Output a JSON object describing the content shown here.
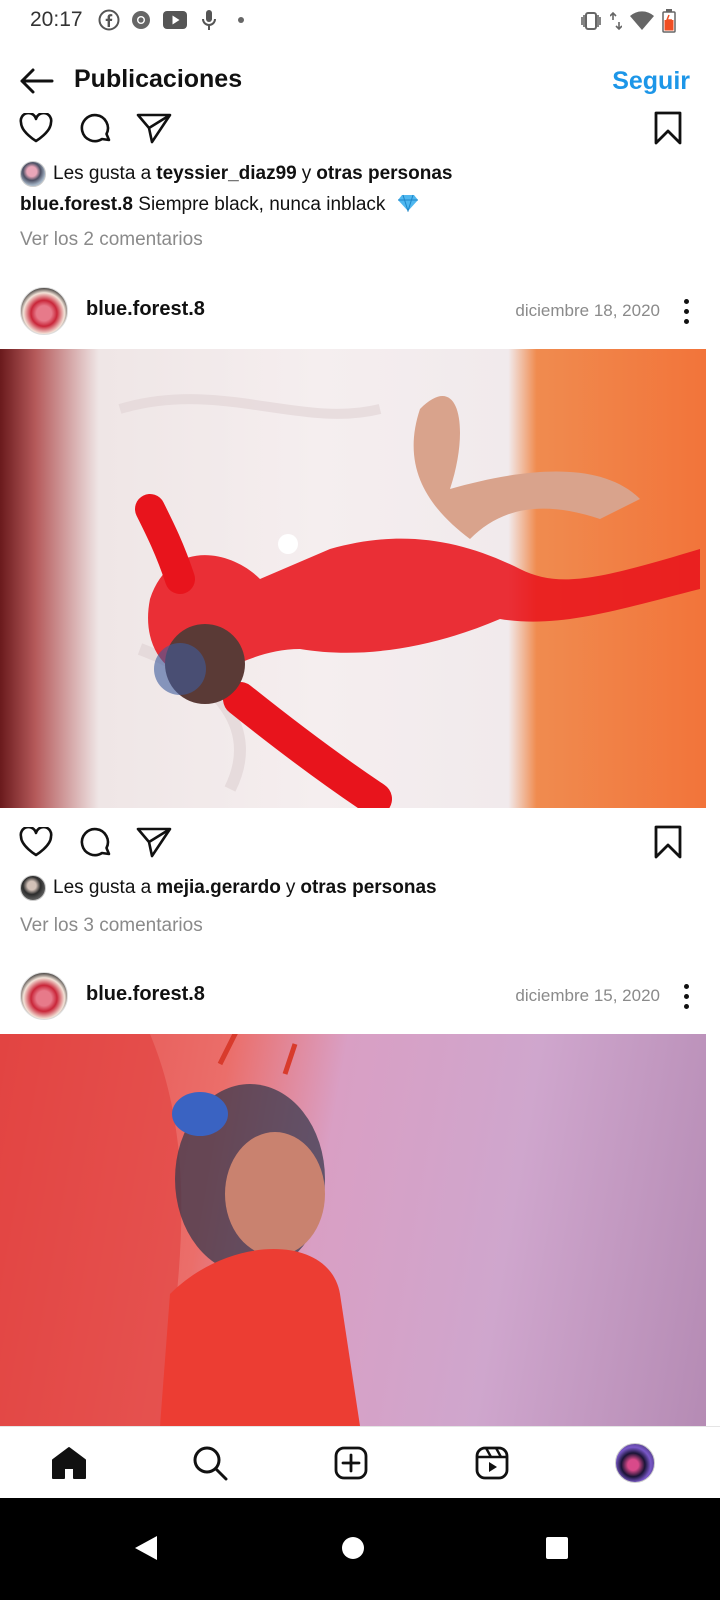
{
  "status_bar": {
    "time": "20:17",
    "icons": [
      "facebook-icon",
      "chrome-icon",
      "youtube-icon",
      "mic-icon",
      "dot-icon"
    ],
    "right_icons": [
      "vibrate-icon",
      "data-arrows-icon",
      "wifi-icon",
      "battery-icon"
    ],
    "battery_color": "#f04e23"
  },
  "nav": {
    "title": "Publicaciones",
    "follow_label": "Seguir",
    "accent": "#1c96e8"
  },
  "posts": [
    {
      "liked_by_prefix": "Les gusta a",
      "liked_by_user": "teyssier_diaz99",
      "liked_by_join": "y",
      "liked_by_others": "otras personas",
      "caption_user": "blue.forest.8",
      "caption_text": "Siempre black, nunca inblack",
      "caption_emoji": "gem-icon",
      "comments_link": "Ver los 2 comentarios"
    },
    {
      "username": "blue.forest.8",
      "date": "diciembre 18, 2020",
      "liked_by_prefix": "Les gusta a",
      "liked_by_user": "mejia.gerardo",
      "liked_by_join": "y",
      "liked_by_others": "otras personas",
      "comments_link": "Ver los 3 comentarios"
    },
    {
      "username": "blue.forest.8",
      "date": "diciembre 15, 2020"
    }
  ],
  "bottom_nav": [
    "home-icon",
    "search-icon",
    "new-post-icon",
    "reels-icon",
    "profile-avatar"
  ],
  "system_nav": [
    "back-icon",
    "home-circle-icon",
    "recents-icon"
  ]
}
